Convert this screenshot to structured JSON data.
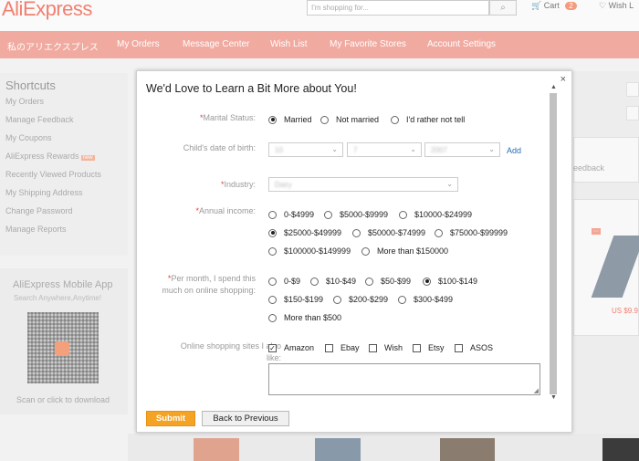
{
  "header": {
    "logo": "AliExpress",
    "search_placeholder": "I'm shopping for...",
    "search_icon": "magnifier-icon",
    "cart_label": "Cart",
    "cart_count": "2",
    "wish_label": "Wish L"
  },
  "nav": {
    "items": [
      "私のアリエクスプレス",
      "My Orders",
      "Message Center",
      "Wish List",
      "My Favorite Stores",
      "Account Settings"
    ]
  },
  "sidebar": {
    "title": "Shortcuts",
    "links": [
      "My Orders",
      "Manage Feedback",
      "My Coupons",
      "AliExpress Rewards",
      "Recently Viewed Products",
      "My Shipping Address",
      "Change Password",
      "Manage Reports"
    ],
    "rewards_badge": "new",
    "mobile_title": "AliExpress Mobile App",
    "mobile_subtitle": "Search Anywhere,Anytime!",
    "scan_text": "Scan or click to download"
  },
  "background_right": {
    "feedback_fragment": "eedback",
    "price_fragment": "US $9.9"
  },
  "modal": {
    "title": "We'd Love to Learn a Bit More about You!",
    "close": "×",
    "marital": {
      "label": "Marital Status:",
      "options": [
        "Married",
        "Not married",
        "I'd rather not tell"
      ],
      "selected": "Married"
    },
    "child_dob": {
      "label": "Child's date of birth:",
      "month": "10",
      "day": "7",
      "year": "2007",
      "add": "Add"
    },
    "industry": {
      "label": "Industry:",
      "value": "Dairy"
    },
    "income": {
      "label": "Annual income:",
      "options": [
        "0-$4999",
        "$5000-$9999",
        "$10000-$24999",
        "$25000-$49999",
        "$50000-$74999",
        "$75000-$99999",
        "$100000-$149999",
        "More than $150000"
      ],
      "selected": "$25000-$49999"
    },
    "spend": {
      "label_line1": "Per month, I spend this",
      "label_line2": "much on online shopping:",
      "options": [
        "0-$9",
        "$10-$49",
        "$50-$99",
        "$100-$149",
        "$150-$199",
        "$200-$299",
        "$300-$499",
        "More than $500"
      ],
      "selected": "$100-$149"
    },
    "sites": {
      "label_line1": "Online shopping sites I also",
      "label_line2": "like:",
      "options": [
        "Amazon",
        "Ebay",
        "Wish",
        "Etsy",
        "ASOS"
      ],
      "checked": [
        "Amazon"
      ]
    },
    "submit": "Submit",
    "back": "Back to Previous"
  }
}
